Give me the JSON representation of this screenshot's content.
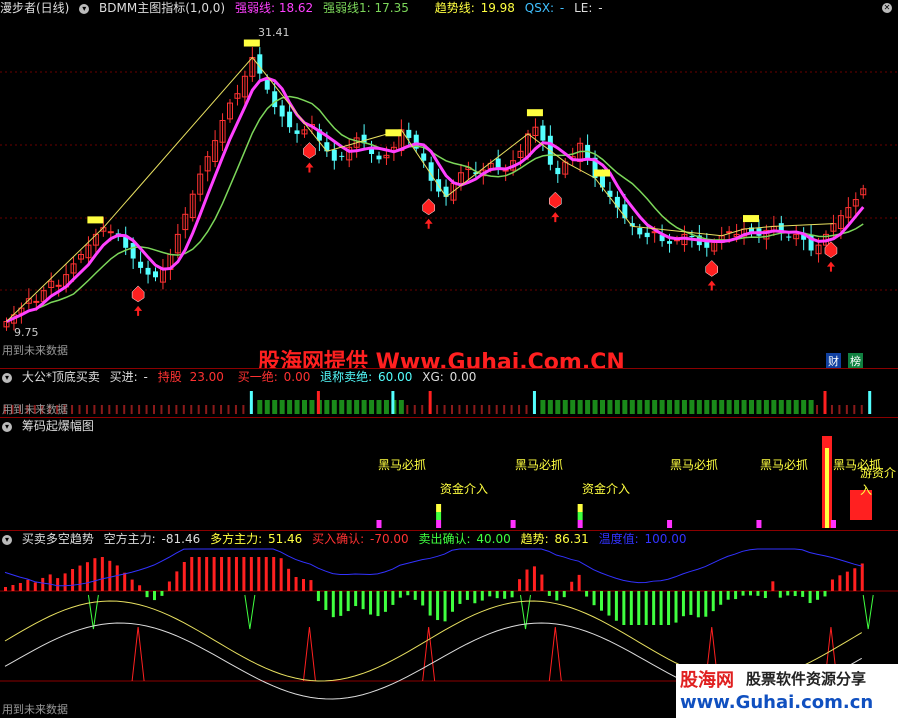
{
  "main": {
    "title": "漫步者(日线)",
    "indicator": "BDMM主图指标(1,0,0)",
    "strong_label": "强弱线:",
    "strong_value": "18.62",
    "strong1_label": "强弱线1:",
    "strong1_value": "17.35",
    "trend_label": "趋势线:",
    "trend_value": "19.98",
    "qsx_label": "QSX:",
    "qsx_value": "-",
    "le_label": "LE:",
    "le_value": "-",
    "high_price": "31.41",
    "low_price": "9.75",
    "footer": "用到未来数据",
    "badge_cai": "财",
    "badge_bang": "榜"
  },
  "panel2": {
    "title": "大公*顶底买卖",
    "buy_label": "买进:",
    "buy_value": "-",
    "hold_label": "持股",
    "hold_value": "23.00",
    "buy_one_label": "买一绝:",
    "buy_one_value": "0.00",
    "exit_label": "退称卖绝:",
    "exit_value": "60.00",
    "xg_label": "XG:",
    "xg_value": "0.00",
    "footer": "用到未来数据"
  },
  "panel3": {
    "title": "筹码起爆幅图",
    "signal_black_horse": "黑马必抓",
    "signal_fund": "资金介入",
    "signal_black_horse_partial": "黑马必抓",
    "signal_trap": "游资介入"
  },
  "panel4": {
    "title": "买卖多空趋势",
    "short_label": "空方主力:",
    "short_value": "-81.46",
    "long_label": "多方主力:",
    "long_value": "51.46",
    "buy_confirm_label": "买入确认:",
    "buy_confirm_value": "-70.00",
    "sell_confirm_label": "卖出确认:",
    "sell_confirm_value": "40.00",
    "trend_label": "趋势:",
    "trend_value": "86.31",
    "temp_label": "温度值:",
    "temp_value": "100.00",
    "footer": "用到未来数据"
  },
  "watermark": {
    "center": "股海网提供 Www.Guhai.Com.CN",
    "corner_brand": "股海网",
    "corner_slogan": "股票软件资源分享",
    "corner_url": "www.Guhai.com.cn"
  },
  "colors": {
    "up": "#ff3232",
    "down": "#54ffff",
    "magenta": "#ff40ff",
    "green_line": "#7cd75a",
    "yellow": "#ffff40",
    "green_bar": "#40ff40",
    "blue": "#3232ff"
  },
  "chart_data": {
    "type": "candlestick",
    "high_label": 31.41,
    "low_label": 9.75,
    "ylim": [
      8,
      33
    ],
    "closes": [
      10.5,
      11.0,
      11.5,
      12.2,
      12.0,
      12.8,
      13.5,
      13.2,
      14.0,
      14.8,
      15.5,
      16.2,
      17.0,
      17.5,
      17.2,
      16.8,
      16.0,
      15.2,
      14.5,
      14.0,
      13.8,
      14.5,
      15.5,
      17.0,
      18.5,
      20.0,
      21.5,
      22.8,
      24.0,
      25.5,
      26.8,
      27.5,
      28.8,
      30.2,
      29.0,
      27.8,
      26.5,
      25.8,
      25.0,
      24.5,
      24.8,
      25.2,
      24.0,
      23.2,
      22.5,
      22.8,
      23.5,
      24.2,
      23.8,
      23.0,
      22.6,
      22.9,
      23.5,
      24.8,
      24.2,
      23.4,
      22.5,
      21.0,
      20.2,
      19.8,
      20.8,
      21.6,
      22.0,
      21.5,
      21.8,
      22.3,
      22.0,
      21.8,
      22.5,
      23.2,
      24.5,
      25.0,
      24.0,
      22.2,
      21.5,
      22.4,
      22.8,
      23.8,
      22.6,
      21.2,
      20.5,
      19.8,
      19.0,
      18.2,
      17.6,
      17.0,
      16.8,
      17.2,
      16.5,
      16.3,
      16.6,
      17.0,
      16.8,
      16.2,
      16.0,
      16.4,
      16.9,
      17.2,
      17.0,
      17.4,
      17.1,
      16.9,
      17.3,
      17.6,
      17.2,
      16.8,
      17.0,
      16.6,
      15.8,
      16.2,
      17.0,
      17.8,
      18.4,
      19.0,
      19.6,
      20.4
    ]
  }
}
